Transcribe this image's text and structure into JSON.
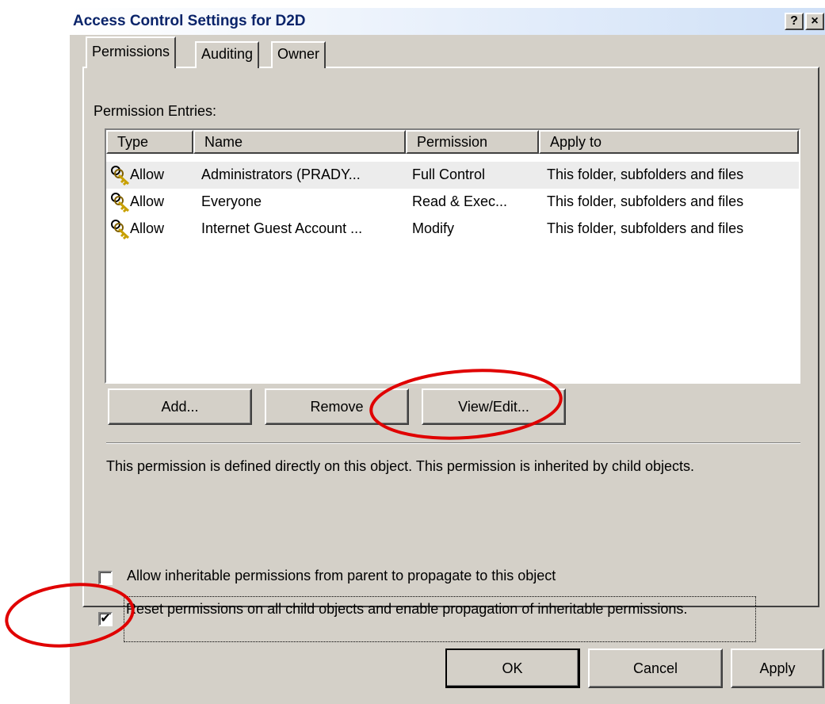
{
  "window": {
    "title": "Access Control Settings for D2D",
    "help_button": "?",
    "close_button": "×"
  },
  "tabs": [
    {
      "label": "Permissions"
    },
    {
      "label": "Auditing"
    },
    {
      "label": "Owner"
    }
  ],
  "permissions": {
    "entries_label": "Permission Entries:",
    "columns": [
      "Type",
      "Name",
      "Permission",
      "Apply to"
    ],
    "rows": [
      {
        "type": "Allow",
        "name": "Administrators (PRADY...",
        "permission": "Full Control",
        "apply_to": "This folder, subfolders and files"
      },
      {
        "type": "Allow",
        "name": "Everyone",
        "permission": "Read & Exec...",
        "apply_to": "This folder, subfolders and files"
      },
      {
        "type": "Allow",
        "name": "Internet Guest Account ...",
        "permission": "Modify",
        "apply_to": "This folder, subfolders and files"
      }
    ],
    "buttons": {
      "add": "Add...",
      "remove": "Remove",
      "view_edit": "View/Edit..."
    },
    "description": "This permission is defined directly on this object. This permission is inherited by child objects.",
    "checkbox_inherit": {
      "label": "Allow inheritable permissions from parent to propagate to this object",
      "checked": false
    },
    "checkbox_reset": {
      "label": "Reset permissions on all child objects and enable propagation of inheritable permissions.",
      "checked": true,
      "mark": "✔"
    }
  },
  "footer": {
    "ok": "OK",
    "cancel": "Cancel",
    "apply": "Apply"
  },
  "colors": {
    "dialog_face": "#d4d0c8",
    "title_text": "#0a246a",
    "annotation_red": "#e00000",
    "key_icon": "#c8a000"
  },
  "icons": {
    "entry_icon": "key-icon"
  }
}
